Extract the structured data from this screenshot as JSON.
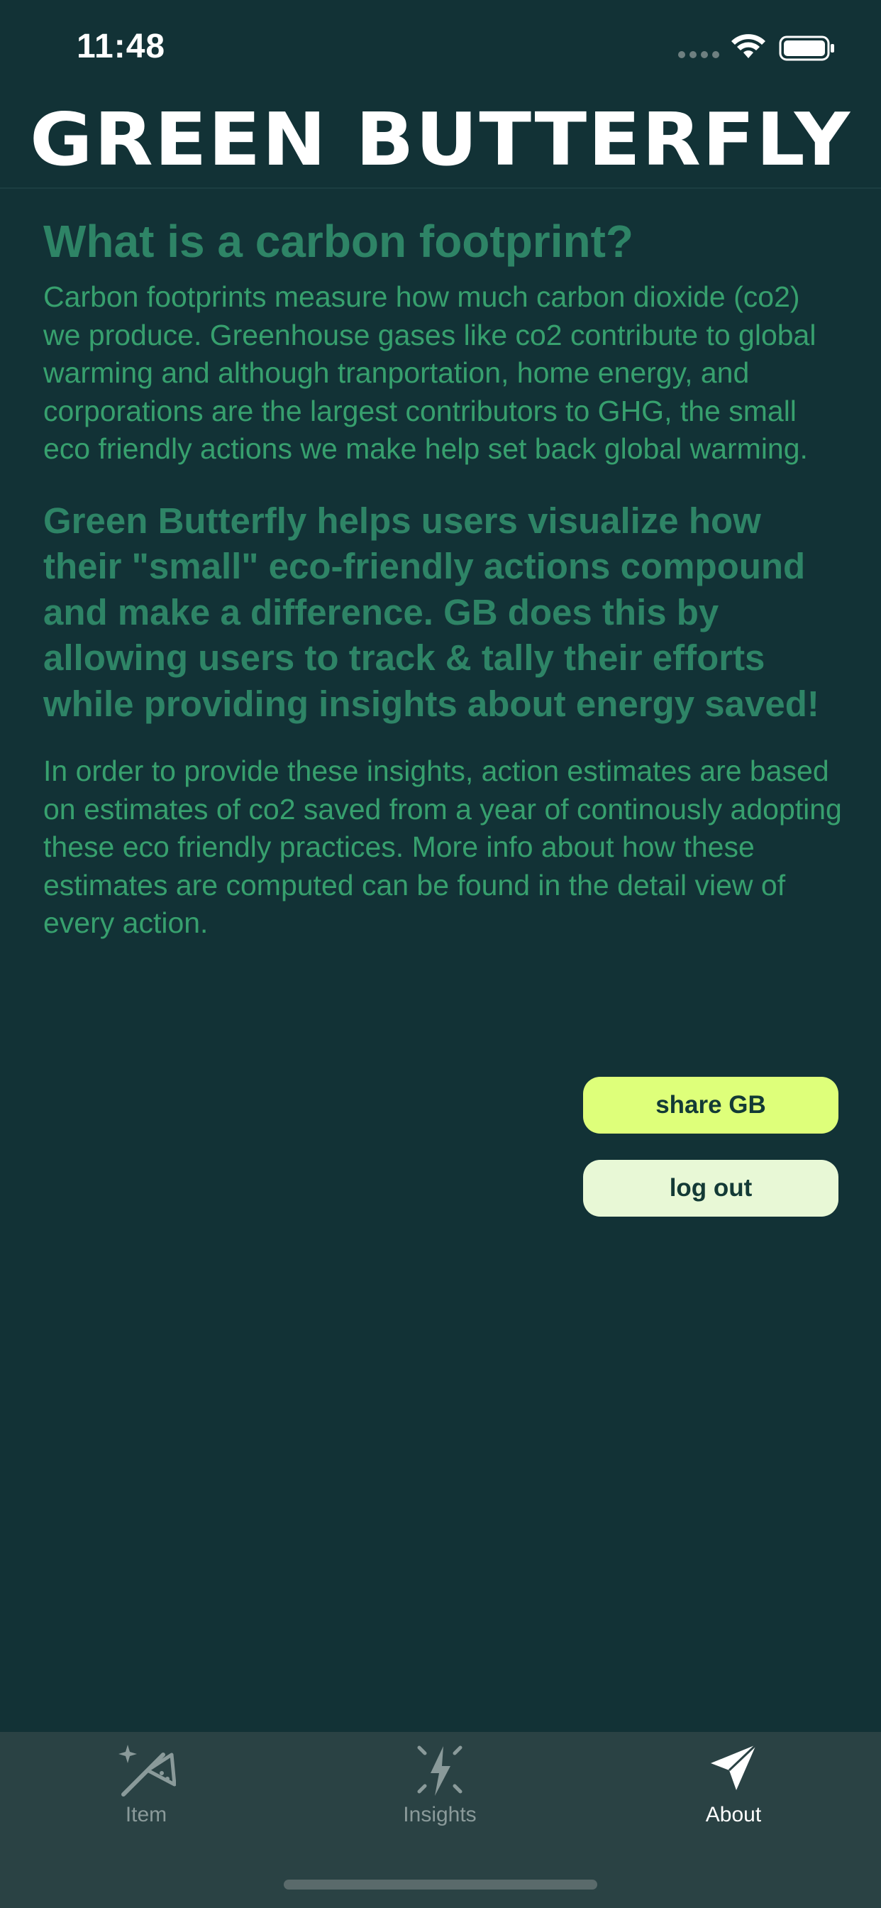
{
  "status_bar": {
    "time": "11:48"
  },
  "header": {
    "title": "GREEN BUTTERFLY"
  },
  "about": {
    "heading": "What is a carbon footprint?",
    "paragraph_1": "Carbon footprints measure how much carbon dioxide (co2) we produce. Greenhouse gases like co2 contribute to global warming and although tranportation, home energy, and corporations are the largest contributors to GHG, the small eco friendly actions we make help set back global warming.",
    "paragraph_2": "Green Butterfly helps users visualize how their \"small\" eco-friendly actions compound and make a difference. GB does this by allowing users to track & tally their efforts while providing insights about energy saved!",
    "paragraph_3": "In order to provide these insights, action estimates are based on estimates of co2 saved from a year of continously adopting these eco friendly practices. More info about how these estimates are computed can be found in the detail view of every action."
  },
  "buttons": {
    "share_label": "share GB",
    "logout_label": "log out"
  },
  "tab_bar": {
    "items": [
      {
        "label": "Item",
        "icon": "magic-wand-icon",
        "active": false
      },
      {
        "label": "Insights",
        "icon": "lightning-bolt-icon",
        "active": false
      },
      {
        "label": "About",
        "icon": "paper-plane-icon",
        "active": true
      }
    ]
  },
  "colors": {
    "background": "#123236",
    "heading": "#2e8466",
    "body_text": "#37a06e",
    "share_button": "#deff7a",
    "logout_button": "#e8f8d6",
    "tab_bar": "#2a4244"
  }
}
